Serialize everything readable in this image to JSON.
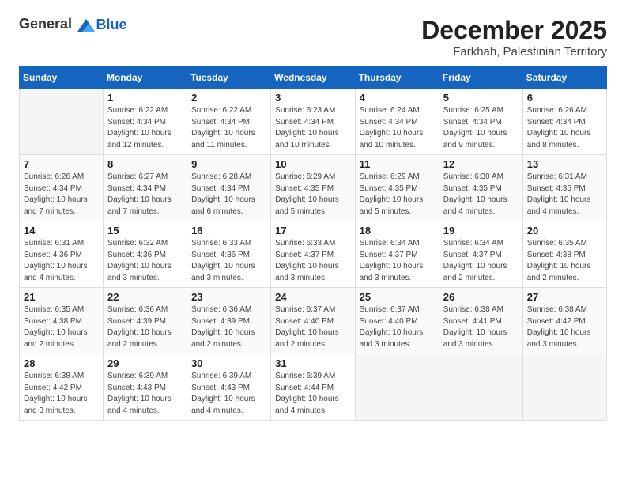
{
  "header": {
    "logo_general": "General",
    "logo_blue": "Blue",
    "main_title": "December 2025",
    "subtitle": "Farkhah, Palestinian Territory"
  },
  "columns": [
    "Sunday",
    "Monday",
    "Tuesday",
    "Wednesday",
    "Thursday",
    "Friday",
    "Saturday"
  ],
  "weeks": [
    [
      {
        "day": "",
        "info": ""
      },
      {
        "day": "1",
        "info": "Sunrise: 6:22 AM\nSunset: 4:34 PM\nDaylight: 10 hours\nand 12 minutes."
      },
      {
        "day": "2",
        "info": "Sunrise: 6:22 AM\nSunset: 4:34 PM\nDaylight: 10 hours\nand 11 minutes."
      },
      {
        "day": "3",
        "info": "Sunrise: 6:23 AM\nSunset: 4:34 PM\nDaylight: 10 hours\nand 10 minutes."
      },
      {
        "day": "4",
        "info": "Sunrise: 6:24 AM\nSunset: 4:34 PM\nDaylight: 10 hours\nand 10 minutes."
      },
      {
        "day": "5",
        "info": "Sunrise: 6:25 AM\nSunset: 4:34 PM\nDaylight: 10 hours\nand 9 minutes."
      },
      {
        "day": "6",
        "info": "Sunrise: 6:26 AM\nSunset: 4:34 PM\nDaylight: 10 hours\nand 8 minutes."
      }
    ],
    [
      {
        "day": "7",
        "info": "Sunrise: 6:26 AM\nSunset: 4:34 PM\nDaylight: 10 hours\nand 7 minutes."
      },
      {
        "day": "8",
        "info": "Sunrise: 6:27 AM\nSunset: 4:34 PM\nDaylight: 10 hours\nand 7 minutes."
      },
      {
        "day": "9",
        "info": "Sunrise: 6:28 AM\nSunset: 4:34 PM\nDaylight: 10 hours\nand 6 minutes."
      },
      {
        "day": "10",
        "info": "Sunrise: 6:29 AM\nSunset: 4:35 PM\nDaylight: 10 hours\nand 5 minutes."
      },
      {
        "day": "11",
        "info": "Sunrise: 6:29 AM\nSunset: 4:35 PM\nDaylight: 10 hours\nand 5 minutes."
      },
      {
        "day": "12",
        "info": "Sunrise: 6:30 AM\nSunset: 4:35 PM\nDaylight: 10 hours\nand 4 minutes."
      },
      {
        "day": "13",
        "info": "Sunrise: 6:31 AM\nSunset: 4:35 PM\nDaylight: 10 hours\nand 4 minutes."
      }
    ],
    [
      {
        "day": "14",
        "info": "Sunrise: 6:31 AM\nSunset: 4:36 PM\nDaylight: 10 hours\nand 4 minutes."
      },
      {
        "day": "15",
        "info": "Sunrise: 6:32 AM\nSunset: 4:36 PM\nDaylight: 10 hours\nand 3 minutes."
      },
      {
        "day": "16",
        "info": "Sunrise: 6:33 AM\nSunset: 4:36 PM\nDaylight: 10 hours\nand 3 minutes."
      },
      {
        "day": "17",
        "info": "Sunrise: 6:33 AM\nSunset: 4:37 PM\nDaylight: 10 hours\nand 3 minutes."
      },
      {
        "day": "18",
        "info": "Sunrise: 6:34 AM\nSunset: 4:37 PM\nDaylight: 10 hours\nand 3 minutes."
      },
      {
        "day": "19",
        "info": "Sunrise: 6:34 AM\nSunset: 4:37 PM\nDaylight: 10 hours\nand 2 minutes."
      },
      {
        "day": "20",
        "info": "Sunrise: 6:35 AM\nSunset: 4:38 PM\nDaylight: 10 hours\nand 2 minutes."
      }
    ],
    [
      {
        "day": "21",
        "info": "Sunrise: 6:35 AM\nSunset: 4:38 PM\nDaylight: 10 hours\nand 2 minutes."
      },
      {
        "day": "22",
        "info": "Sunrise: 6:36 AM\nSunset: 4:39 PM\nDaylight: 10 hours\nand 2 minutes."
      },
      {
        "day": "23",
        "info": "Sunrise: 6:36 AM\nSunset: 4:39 PM\nDaylight: 10 hours\nand 2 minutes."
      },
      {
        "day": "24",
        "info": "Sunrise: 6:37 AM\nSunset: 4:40 PM\nDaylight: 10 hours\nand 2 minutes."
      },
      {
        "day": "25",
        "info": "Sunrise: 6:37 AM\nSunset: 4:40 PM\nDaylight: 10 hours\nand 3 minutes."
      },
      {
        "day": "26",
        "info": "Sunrise: 6:38 AM\nSunset: 4:41 PM\nDaylight: 10 hours\nand 3 minutes."
      },
      {
        "day": "27",
        "info": "Sunrise: 6:38 AM\nSunset: 4:42 PM\nDaylight: 10 hours\nand 3 minutes."
      }
    ],
    [
      {
        "day": "28",
        "info": "Sunrise: 6:38 AM\nSunset: 4:42 PM\nDaylight: 10 hours\nand 3 minutes."
      },
      {
        "day": "29",
        "info": "Sunrise: 6:39 AM\nSunset: 4:43 PM\nDaylight: 10 hours\nand 4 minutes."
      },
      {
        "day": "30",
        "info": "Sunrise: 6:39 AM\nSunset: 4:43 PM\nDaylight: 10 hours\nand 4 minutes."
      },
      {
        "day": "31",
        "info": "Sunrise: 6:39 AM\nSunset: 4:44 PM\nDaylight: 10 hours\nand 4 minutes."
      },
      {
        "day": "",
        "info": ""
      },
      {
        "day": "",
        "info": ""
      },
      {
        "day": "",
        "info": ""
      }
    ]
  ]
}
